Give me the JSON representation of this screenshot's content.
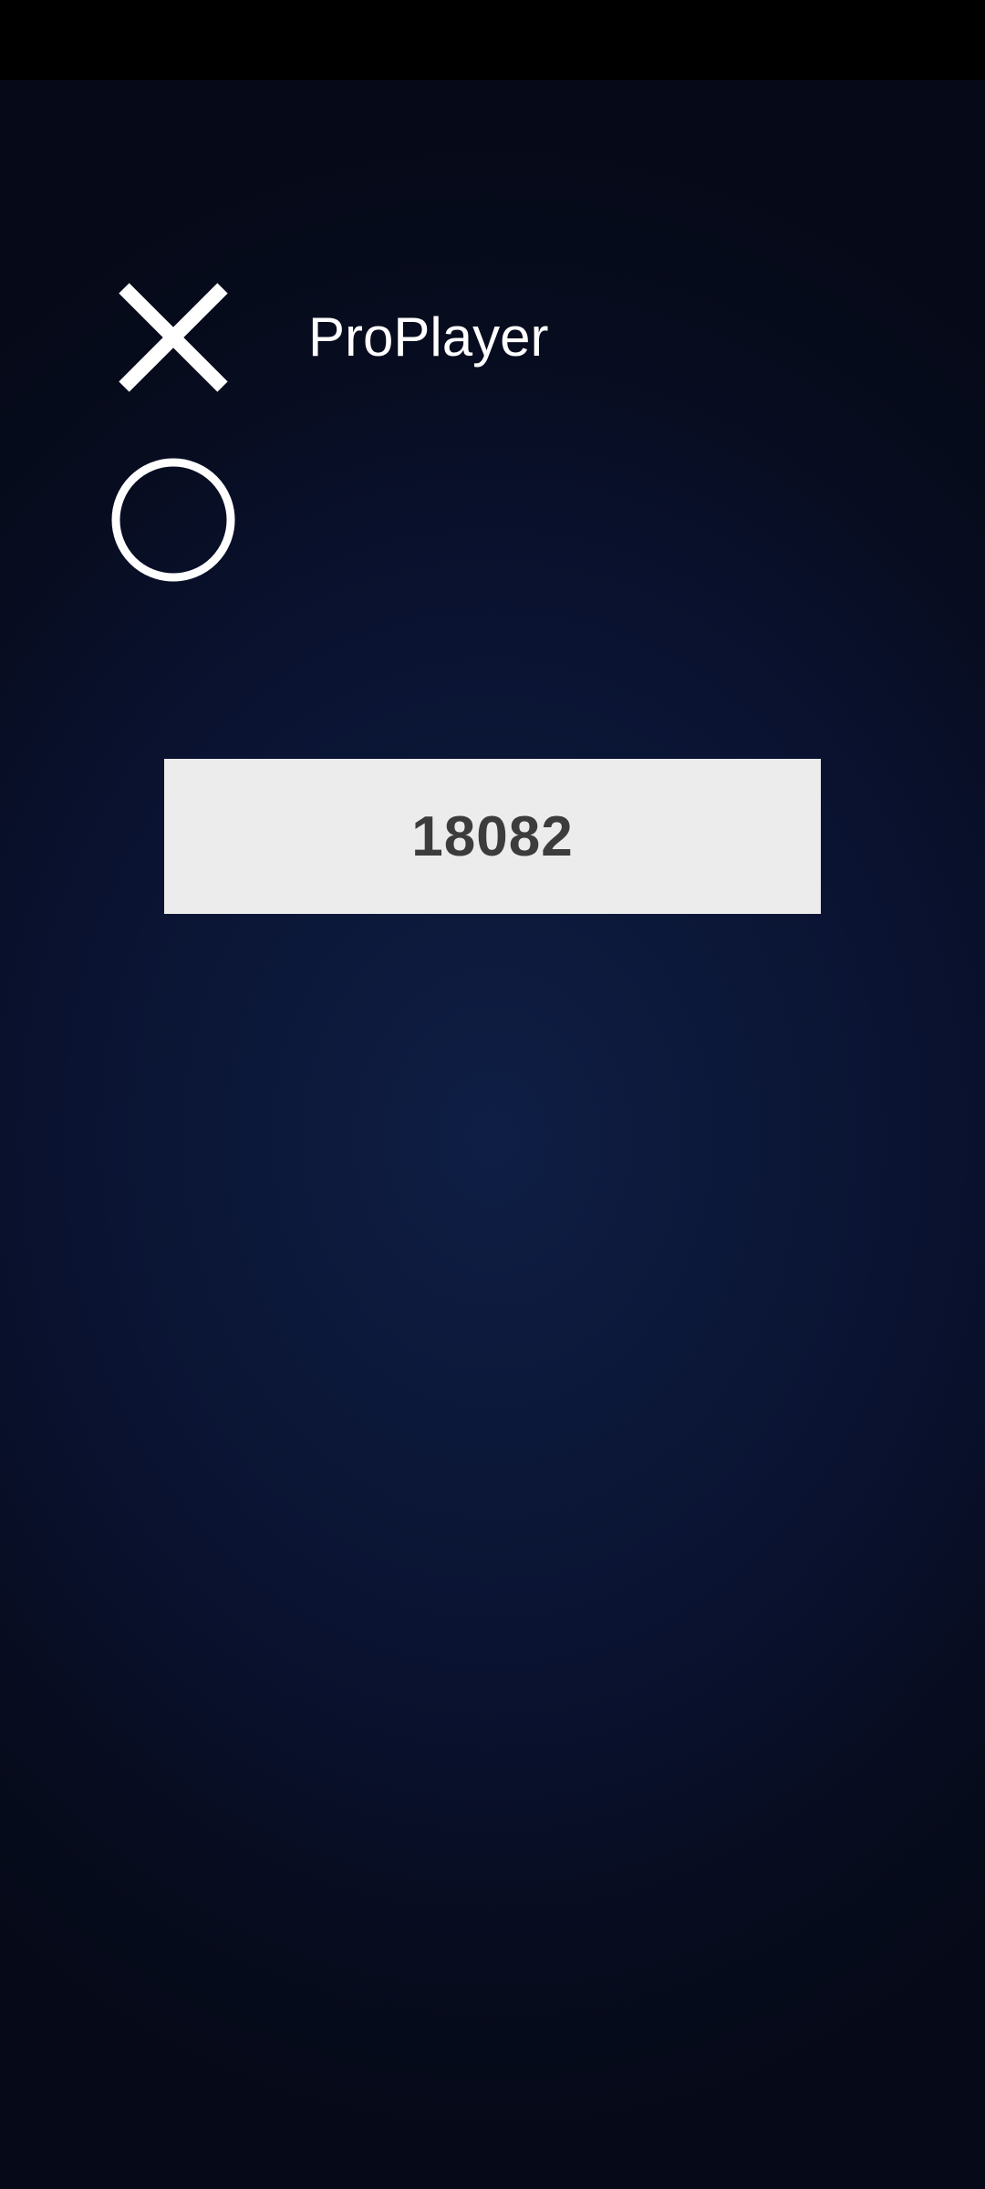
{
  "players": {
    "x": {
      "name": "ProPlayer",
      "icon": "x-mark-icon"
    },
    "o": {
      "name": "",
      "icon": "o-mark-icon"
    }
  },
  "score": {
    "value": "18082"
  },
  "colors": {
    "background_center": "#0f1e45",
    "background_edge": "#060a18",
    "status_bar": "#000000",
    "mark": "#ffffff",
    "score_box": "#ececec",
    "score_text": "#3c3c3c"
  }
}
